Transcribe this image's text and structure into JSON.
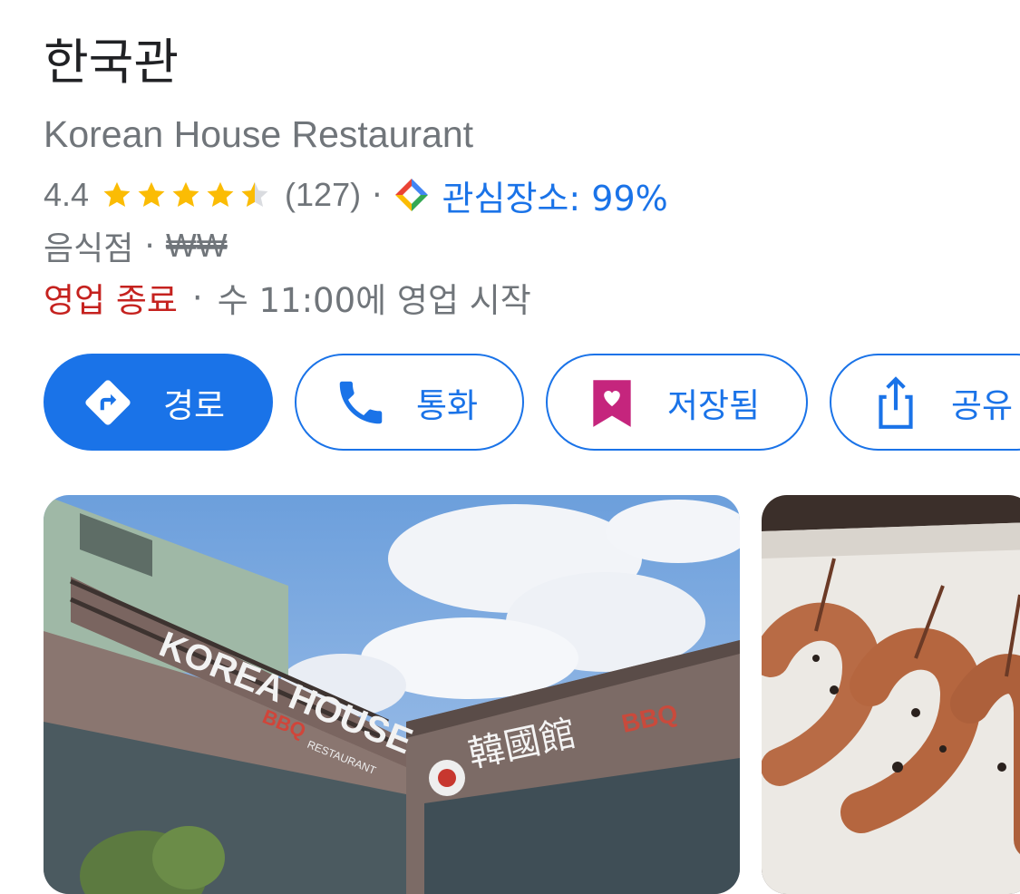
{
  "place": {
    "title": "한국관",
    "subtitle": "Korean House Restaurant"
  },
  "rating": {
    "value": "4.4",
    "stars": 4.5,
    "count": "(127)",
    "separator": "·",
    "interest_label": "관심장소: 99%"
  },
  "category": {
    "type": "음식점",
    "separator": "·",
    "price": "₩₩"
  },
  "hours": {
    "status": "영업 종료",
    "separator": "·",
    "detail": "수 11:00에 영업 시작"
  },
  "actions": {
    "directions_label": "경로",
    "call_label": "통화",
    "save_label": "저장됨",
    "share_label": "공유"
  },
  "photos": {
    "sign_korea_house": "KOREA HOUSE",
    "sign_bbq": "BBQ",
    "sign_restaurant": "RESTAURANT",
    "sign_hanja": "韓國館",
    "sign_bbq_right": "BBQ"
  },
  "colors": {
    "accent": "#1a73e8",
    "star": "#fbbc04",
    "closed": "#c5221f",
    "save_icon": "#c5257d",
    "muted": "#70757a"
  }
}
